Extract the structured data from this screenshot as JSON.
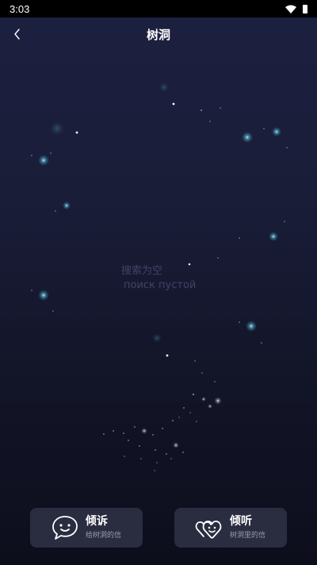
{
  "status_bar": {
    "time": "3:03"
  },
  "header": {
    "title": "树洞"
  },
  "main": {
    "empty_text": "搜索为空",
    "empty_text_translated": "поиск пустой"
  },
  "actions": [
    {
      "title": "倾诉",
      "subtitle": "给树洞的信",
      "icon": "speech-bubble-smile-icon"
    },
    {
      "title": "倾听",
      "subtitle": "树洞里的信",
      "icon": "hearts-icon"
    }
  ]
}
